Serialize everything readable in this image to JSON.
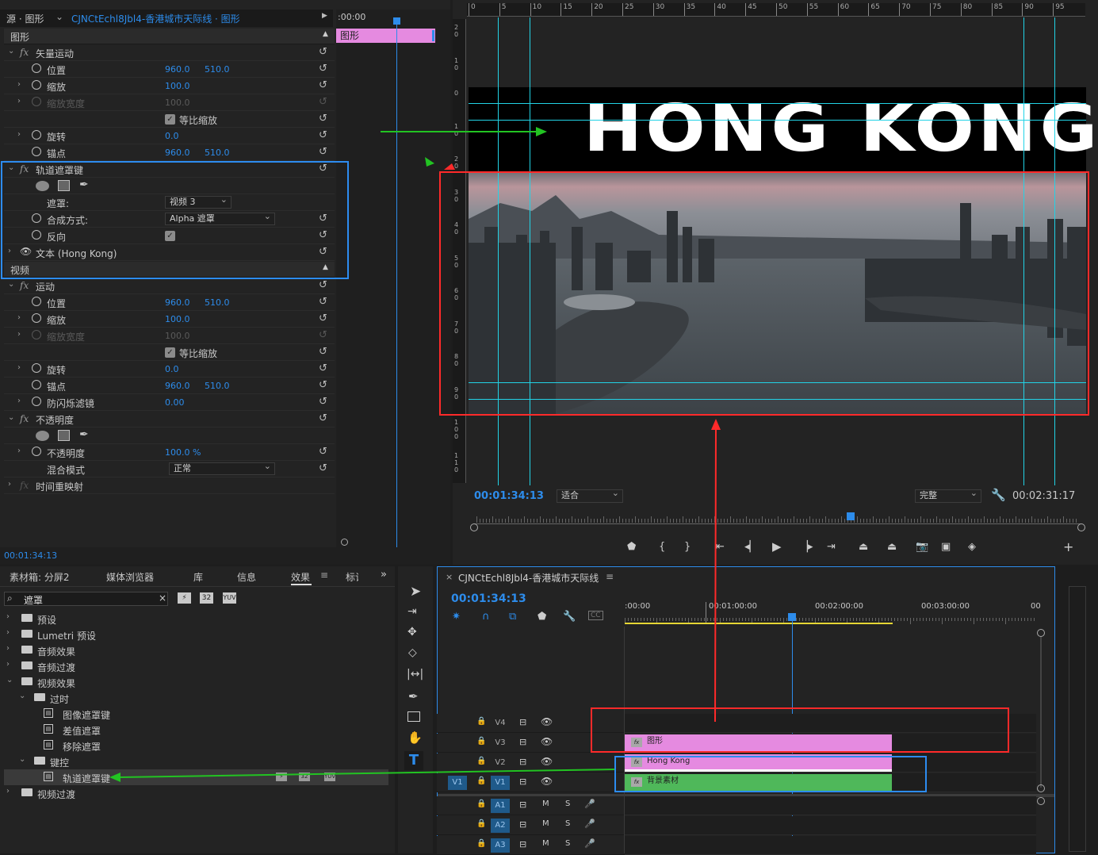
{
  "effect_controls": {
    "tab_source": "源 · 图形",
    "tab_clip": "CJNCtEchl8Jbl4-香港城市天际线 · 图形",
    "ruler_time": ":00:00",
    "clip_label": "图形",
    "section_graphics": "图形",
    "vector_motion": "矢量运动",
    "position_label": "位置",
    "pos_x": "960.0",
    "pos_y": "510.0",
    "scale_label": "缩放",
    "scale_val": "100.0",
    "scale_width_label": "缩放宽度",
    "scale_width_val": "100.0",
    "uniform_scale": "等比缩放",
    "rotation_label": "旋转",
    "rotation_val": "0.0",
    "anchor_label": "锚点",
    "anchor_x": "960.0",
    "anchor_y": "510.0",
    "track_matte_key": "轨道遮罩键",
    "matte_label": "遮罩:",
    "matte_value": "视频 3",
    "composite_label": "合成方式:",
    "composite_value": "Alpha 遮罩",
    "reverse_label": "反向",
    "text_layer": "文本 (Hong Kong)",
    "section_video": "视频",
    "motion": "运动",
    "m_pos_x": "960.0",
    "m_pos_y": "510.0",
    "m_scale": "100.0",
    "m_scale_width": "100.0",
    "m_rotation": "0.0",
    "m_anchor_x": "960.0",
    "m_anchor_y": "510.0",
    "antiflicker_label": "防闪烁滤镜",
    "antiflicker_val": "0.00",
    "opacity_section": "不透明度",
    "opacity_label": "不透明度",
    "opacity_val": "100.0 %",
    "blend_label": "混合模式",
    "blend_value": "正常",
    "time_remap": "时间重映射",
    "timecode": "00:01:34:13"
  },
  "program_monitor": {
    "ruler_ticks": [
      "0",
      "5",
      "10",
      "15",
      "20",
      "25",
      "30",
      "35",
      "40",
      "45",
      "50",
      "55",
      "60",
      "65",
      "70",
      "75",
      "80",
      "85",
      "90",
      "95"
    ],
    "v_ticks": [
      "2 0",
      "1 0",
      "0",
      "1 0",
      "2 0",
      "3 0",
      "4 0",
      "5 0",
      "6 0",
      "7 0",
      "8 0",
      "9 0",
      "1 0 0",
      "1 1 0"
    ],
    "title_text": "HONG KONG",
    "timecode": "00:01:34:13",
    "fit_value": "适合",
    "quality_value": "完整",
    "duration": "00:02:31:17"
  },
  "project_panel": {
    "tabs": [
      "素材箱: 分屏2",
      "媒体浏览器",
      "库",
      "信息",
      "效果",
      "标记"
    ],
    "search_value": "遮罩",
    "badges": [
      "32",
      "YUV"
    ],
    "tree": [
      {
        "label": "预设",
        "level": 0,
        "open": false
      },
      {
        "label": "Lumetri 预设",
        "level": 0,
        "open": false
      },
      {
        "label": "音频效果",
        "level": 0,
        "open": false
      },
      {
        "label": "音频过渡",
        "level": 0,
        "open": false
      },
      {
        "label": "视频效果",
        "level": 0,
        "open": true
      },
      {
        "label": "过时",
        "level": 1,
        "open": true
      },
      {
        "label": "图像遮罩键",
        "level": 2,
        "effect": true
      },
      {
        "label": "差值遮罩",
        "level": 2,
        "effect": true
      },
      {
        "label": "移除遮罩",
        "level": 2,
        "effect": true
      },
      {
        "label": "键控",
        "level": 1,
        "open": true
      },
      {
        "label": "轨道遮罩键",
        "level": 2,
        "effect": true,
        "selected": true
      },
      {
        "label": "视频过渡",
        "level": 0,
        "open": false
      }
    ]
  },
  "timeline": {
    "sequence_name": "CJNCtEchl8Jbl4-香港城市天际线",
    "timecode": "00:01:34:13",
    "ruler_labels": [
      ":00:00",
      "00:01:00:00",
      "00:02:00:00",
      "00:03:00:00",
      "00"
    ],
    "tracks": [
      "V4",
      "V3",
      "V2",
      "V1",
      "A1",
      "A2",
      "A3"
    ],
    "source_patch": "V1",
    "track_buttons": [
      "M",
      "S"
    ],
    "clip_graphics": "图形",
    "clip_text": "Hong Kong",
    "clip_bg": "背景素材"
  },
  "colors": {
    "accent": "#2d8ceb",
    "pink": "#e58ae0",
    "green": "#4fb85a",
    "red_annot": "#ff2a2a",
    "blue_annot": "#2d8cf0",
    "green_annot": "#22c322",
    "cyan_guide": "#22d3e6"
  }
}
